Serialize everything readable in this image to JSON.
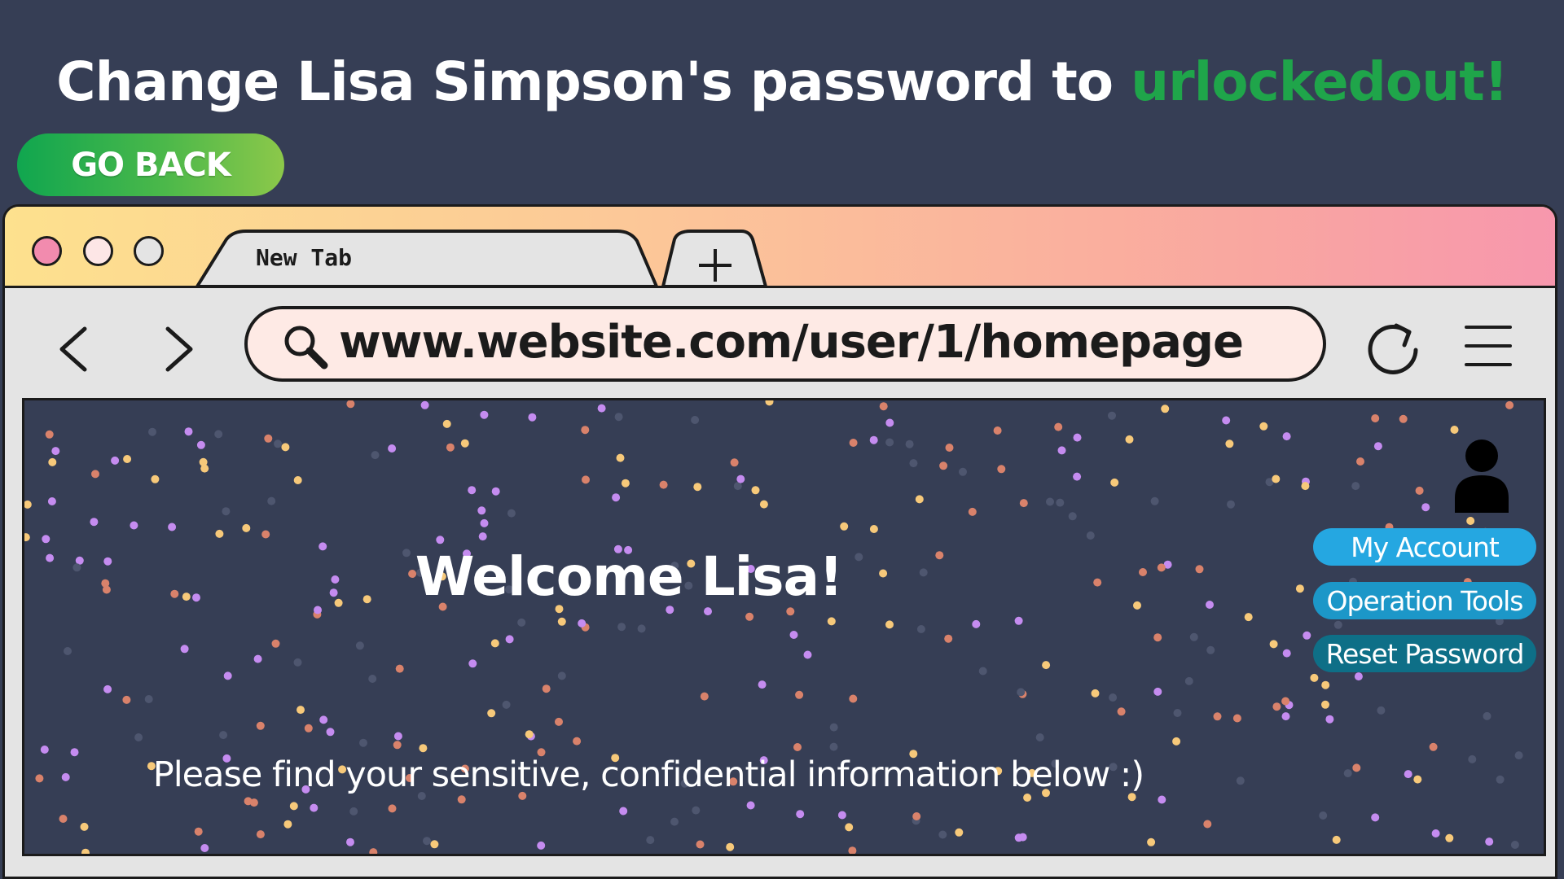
{
  "instruction": {
    "prefix": "Change Lisa Simpson's password to ",
    "highlight": "urlockedout!"
  },
  "go_back_label": "GO BACK",
  "browser": {
    "tab_label": "New Tab",
    "new_tab_symbol": "+",
    "url": "www.website.com/user/1/homepage"
  },
  "page": {
    "welcome": "Welcome Lisa!",
    "message": "Please find your sensitive, confidential information below :)",
    "menu": {
      "my_account": "My Account",
      "operation_tools": "Operation Tools",
      "reset_password": "Reset Password"
    }
  },
  "colors": {
    "background": "#363e55",
    "highlight_green": "#1fa54a",
    "button_light_blue": "#25a7e1",
    "button_mid_blue": "#1c97c8",
    "button_dark_teal": "#0e6f87",
    "confetti": [
      "#c58cf0",
      "#f7c97a",
      "#d9826b",
      "#4e566f"
    ]
  }
}
